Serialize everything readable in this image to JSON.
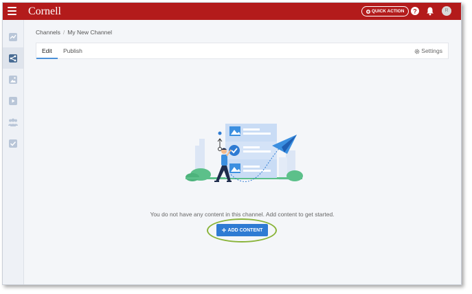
{
  "app": {
    "brand": "Cornell",
    "quick_action_label": "QUICK ACTION",
    "avatar_initial": "R"
  },
  "icons": {
    "menu": "hamburger-icon",
    "quick_action": "plus-icon",
    "help": "help-circle-icon",
    "notifications": "bell-icon",
    "settings": "gear-icon",
    "add": "plus-icon"
  },
  "sidebar": {
    "items": [
      {
        "icon": "analytics-icon",
        "active": false
      },
      {
        "icon": "share-icon",
        "active": true
      },
      {
        "icon": "image-icon",
        "active": false
      },
      {
        "icon": "video-icon",
        "active": false
      },
      {
        "icon": "users-icon",
        "active": false
      },
      {
        "icon": "checkbox-icon",
        "active": false
      }
    ]
  },
  "breadcrumb": {
    "root": "Channels",
    "separator": "/",
    "current": "My New Channel"
  },
  "tabs": {
    "items": [
      {
        "label": "Edit",
        "active": true
      },
      {
        "label": "Publish",
        "active": false
      }
    ],
    "settings_label": "Settings"
  },
  "empty_state": {
    "message": "You do not have any content in this channel. Add content to get started.",
    "button_label": "ADD CONTENT"
  },
  "colors": {
    "brand_red": "#b31b1b",
    "primary_blue": "#2e7bd3",
    "tab_underline": "#4a90d9",
    "highlight_green": "#8ab43a"
  }
}
